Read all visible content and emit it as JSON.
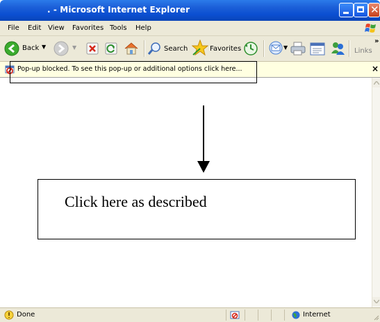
{
  "window": {
    "title": ". - Microsoft Internet Explorer"
  },
  "menu": [
    "File",
    "Edit",
    "View",
    "Favorites",
    "Tools",
    "Help"
  ],
  "toolbar": {
    "back_label": "Back",
    "search_label": "Search",
    "favorites_label": "Favorites",
    "links_label": "Links",
    "overflow_glyph": "»"
  },
  "infobar": {
    "message": "Pop-up blocked. To see this pop-up or additional options click here...",
    "close_glyph": "×"
  },
  "annotation": {
    "callout_text": "Click here as described"
  },
  "status": {
    "left_text": "Done",
    "zone_text": "Internet"
  },
  "colors": {
    "titlebar": "#0b4fd1",
    "chrome": "#ece9d8",
    "infobar": "#ffffe1"
  }
}
